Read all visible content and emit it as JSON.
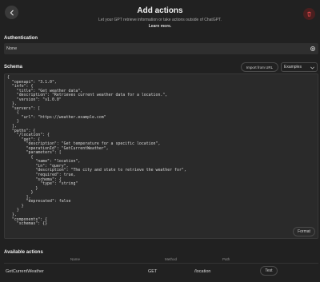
{
  "header": {
    "title": "Add actions",
    "subtitle": "Let your GPT retrieve information or take actions outside of ChatGPT.",
    "learn_more": "Learn more."
  },
  "authentication": {
    "label": "Authentication",
    "value": "None"
  },
  "schema": {
    "label": "Schema",
    "import_button": "Import from URL",
    "examples_select": "Examples",
    "format_button": "Format",
    "code_lines": [
      "{",
      "  \"openapi\": \"3.1.0\",",
      "  \"info\": {",
      "    \"title\": \"Get weather data\",",
      "    \"description\": \"Retrieves current weather data for a location.\",",
      "    \"version\": \"v1.0.0\"",
      "  },",
      "  \"servers\": [",
      "    {",
      "      \"url\": \"https://weather.example.com\"",
      "    }",
      "  ],",
      "  \"paths\": {",
      "    \"/location\": {",
      "      \"get\": {",
      "        \"description\": \"Get temperature for a specific location\",",
      "        \"operationId\": \"GetCurrentWeather\",",
      "        \"parameters\": [",
      "          {",
      "            \"name\": \"location\",",
      "            \"in\": \"query\",",
      "            \"description\": \"The city and state to retrieve the weather for\",",
      "            \"required\": true,",
      "            \"schema\": {",
      "              \"type\": \"string\"",
      "            }",
      "          }",
      "        ],",
      "        \"deprecated\": false",
      "      }",
      "    }",
      "  },",
      "  \"components\": {",
      "    \"schemas\": {}"
    ]
  },
  "available_actions": {
    "label": "Available actions",
    "columns": [
      "Name",
      "Method",
      "Path"
    ],
    "rows": [
      {
        "name": "GetCurrentWeather",
        "method": "GET",
        "path": "/location",
        "test_label": "Test"
      }
    ]
  },
  "colors": {
    "background": "#212121",
    "panel": "#2f2f2f",
    "danger": "#e5484d"
  }
}
